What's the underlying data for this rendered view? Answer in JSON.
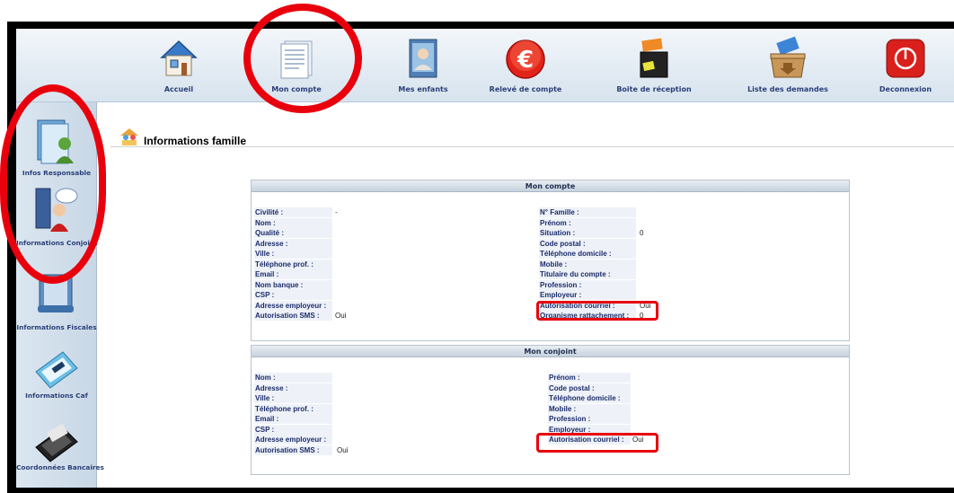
{
  "topnav": {
    "items": [
      {
        "label": "Accueil",
        "icon": "home-icon"
      },
      {
        "label": "Mon compte",
        "icon": "document-icon"
      },
      {
        "label": "Mes enfants",
        "icon": "photo-icon"
      },
      {
        "label": "Relevé de compte",
        "icon": "euro-icon"
      },
      {
        "label": "Boite de réception",
        "icon": "inbox-icon"
      },
      {
        "label": "Liste des demandes",
        "icon": "box-icon"
      },
      {
        "label": "Deconnexion",
        "icon": "power-icon"
      }
    ]
  },
  "sidebar": {
    "items": [
      {
        "label": "Infos Responsable",
        "icon": "user-card-icon"
      },
      {
        "label": "Informations Conjoint",
        "icon": "couple-icon"
      },
      {
        "label": "Informations Fiscales",
        "icon": "tax-icon"
      },
      {
        "label": "Informations Caf",
        "icon": "caf-icon"
      },
      {
        "label": "Coordonnées Bancaires",
        "icon": "bank-card-icon"
      }
    ]
  },
  "page": {
    "title": "Informations famille"
  },
  "mon_compte": {
    "title": "Mon compte",
    "left": [
      {
        "label": "Civilité :",
        "value": "-"
      },
      {
        "label": "Nom :",
        "value": ""
      },
      {
        "label": "Qualité :",
        "value": ""
      },
      {
        "label": "Adresse :",
        "value": ""
      },
      {
        "label": "Ville :",
        "value": ""
      },
      {
        "label": "Téléphone prof. :",
        "value": ""
      },
      {
        "label": "Email :",
        "value": ""
      },
      {
        "label": "Nom banque :",
        "value": ""
      },
      {
        "label": "CSP :",
        "value": ""
      },
      {
        "label": "Adresse employeur :",
        "value": ""
      },
      {
        "label": "Autorisation SMS :",
        "value": "Oui"
      }
    ],
    "right": [
      {
        "label": "N° Famille :",
        "value": ""
      },
      {
        "label": "Prénom :",
        "value": ""
      },
      {
        "label": "Situation :",
        "value": "0"
      },
      {
        "label": "Code postal :",
        "value": ""
      },
      {
        "label": "Téléphone domicile :",
        "value": ""
      },
      {
        "label": "Mobile :",
        "value": ""
      },
      {
        "label": "Titulaire du compte :",
        "value": ""
      },
      {
        "label": "Profession :",
        "value": ""
      },
      {
        "label": "Employeur :",
        "value": ""
      },
      {
        "label": "Autorisation courriel :",
        "value": "Oui"
      },
      {
        "label": "Organisme rattachement :",
        "value": "0"
      }
    ]
  },
  "mon_conjoint": {
    "title": "Mon conjoint",
    "left": [
      {
        "label": "Nom :",
        "value": ""
      },
      {
        "label": "Adresse :",
        "value": ""
      },
      {
        "label": "Ville :",
        "value": ""
      },
      {
        "label": "Téléphone prof. :",
        "value": ""
      },
      {
        "label": "Email :",
        "value": ""
      },
      {
        "label": "CSP :",
        "value": ""
      },
      {
        "label": "Adresse employeur :",
        "value": ""
      },
      {
        "label": "Autorisation SMS :",
        "value": "Oui"
      }
    ],
    "right": [
      {
        "label": "Prénom :",
        "value": ""
      },
      {
        "label": "Code postal :",
        "value": ""
      },
      {
        "label": "Téléphone domicile :",
        "value": ""
      },
      {
        "label": "Mobile :",
        "value": ""
      },
      {
        "label": "Profession :",
        "value": ""
      },
      {
        "label": "Employeur :",
        "value": ""
      },
      {
        "label": "Autorisation courriel :",
        "value": "Oui"
      }
    ]
  },
  "colors": {
    "annotation": "#e8000d",
    "label_text": "#1c2c6a",
    "nav_text": "#2a3f78"
  }
}
